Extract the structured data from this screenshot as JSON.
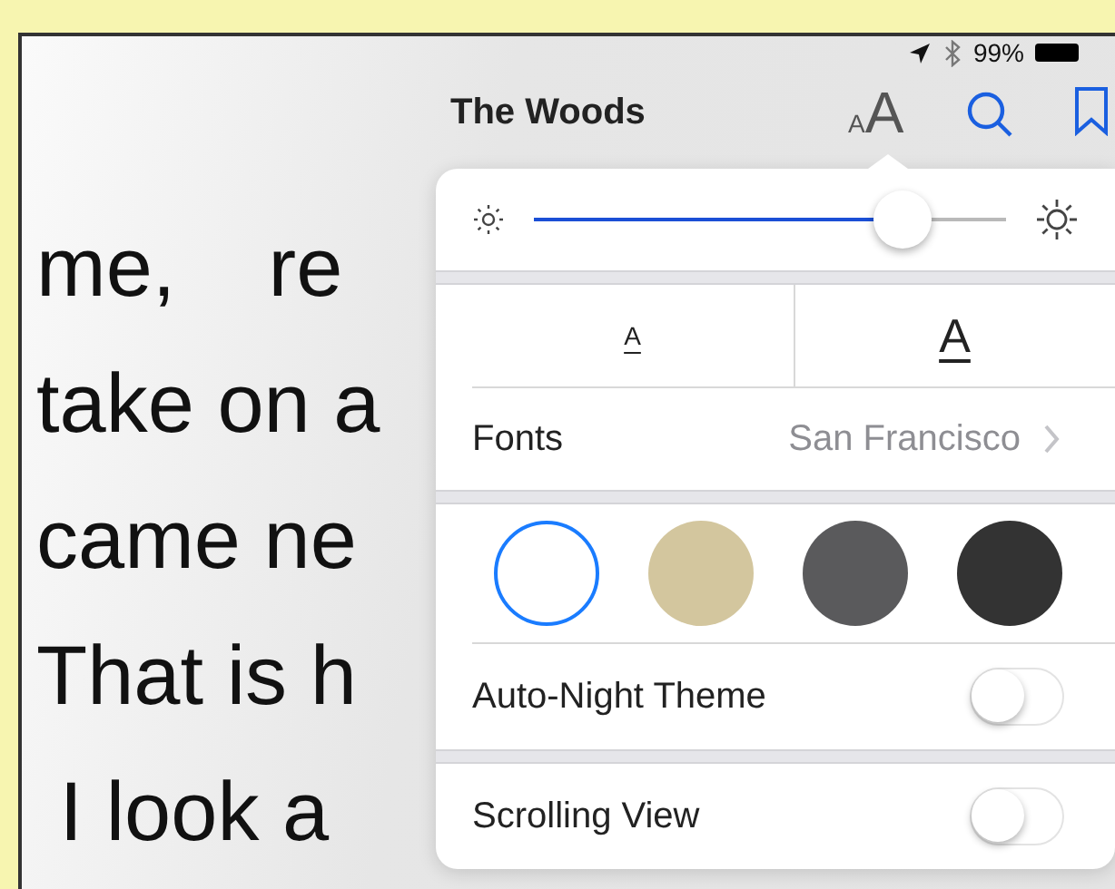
{
  "status_bar": {
    "battery": "99%"
  },
  "toolbar": {
    "title": "The Woods",
    "text_button": {
      "small": "A",
      "large": "A"
    }
  },
  "page_text": [
    "me,    re",
    "take on a",
    "came ne",
    "That is h",
    " I look a"
  ],
  "settings": {
    "brightness": {
      "level": 0.78
    },
    "text_size": {
      "smaller": "A",
      "larger": "A"
    },
    "fonts": {
      "label": "Fonts",
      "value": "San Francisco"
    },
    "themes": [
      {
        "color": "#ffffff",
        "selected": true
      },
      {
        "color": "#d3c69e",
        "selected": false
      },
      {
        "color": "#5a5a5c",
        "selected": false
      },
      {
        "color": "#333333",
        "selected": false
      }
    ],
    "toggles": [
      {
        "label": "Auto-Night Theme",
        "on": false
      },
      {
        "label": "Scrolling View",
        "on": false
      }
    ]
  }
}
